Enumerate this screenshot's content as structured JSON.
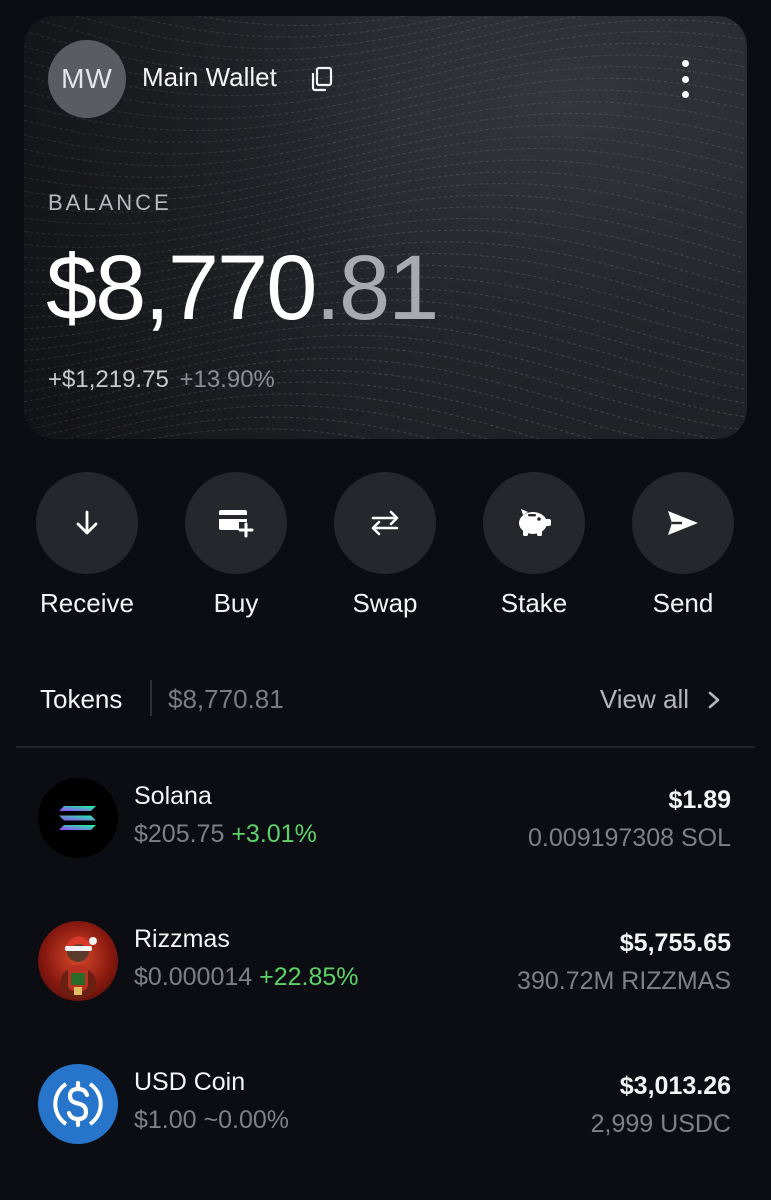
{
  "wallet": {
    "avatar_initials": "MW",
    "name": "Main Wallet",
    "balance_label": "BALANCE",
    "balance_main": "$8,770",
    "balance_cents": ".81",
    "change_abs": "+$1,219.75",
    "change_pct": "+13.90%"
  },
  "actions": [
    {
      "label": "Receive",
      "icon": "arrow-down-icon"
    },
    {
      "label": "Buy",
      "icon": "card-plus-icon"
    },
    {
      "label": "Swap",
      "icon": "swap-arrows-icon"
    },
    {
      "label": "Stake",
      "icon": "piggy-bank-icon"
    },
    {
      "label": "Send",
      "icon": "paper-plane-icon"
    }
  ],
  "tokens": {
    "title": "Tokens",
    "total": "$8,770.81",
    "view_all": "View all",
    "items": [
      {
        "name": "Solana",
        "price": "$205.75",
        "change": "+3.01%",
        "value": "$1.89",
        "amount": "0.009197308 SOL",
        "icon": "solana-logo-icon"
      },
      {
        "name": "Rizzmas",
        "price": "$0.000014",
        "change": "+22.85%",
        "value": "$5,755.65",
        "amount": "390.72M RIZZMAS",
        "icon": "rizzmas-logo-icon"
      },
      {
        "name": "USD Coin",
        "price": "$1.00",
        "change": "~0.00%",
        "value": "$3,013.26",
        "amount": "2,999 USDC",
        "icon": "usdc-logo-icon"
      }
    ]
  },
  "colors": {
    "background": "#0b0d12",
    "card": "#24262b",
    "action_circle": "#26272c",
    "positive": "#5fd16a",
    "muted": "#7f8086",
    "usdc_blue": "#2775ca"
  }
}
